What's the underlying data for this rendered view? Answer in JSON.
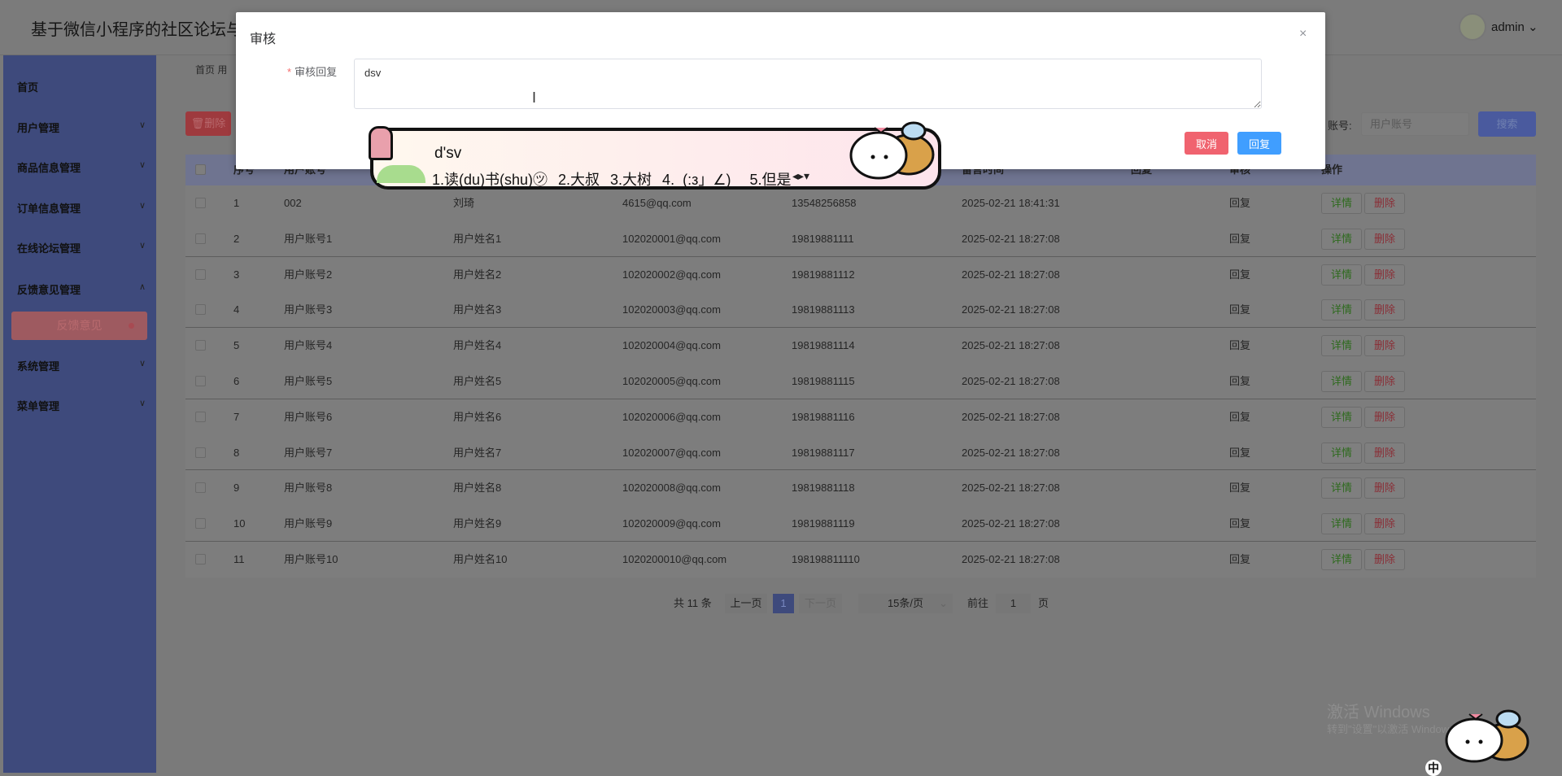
{
  "header": {
    "title": "基于微信小程序的社区论坛与二",
    "user": "admin",
    "user_chevron": "⌄"
  },
  "sidebar": {
    "items": [
      {
        "label": "首页",
        "chevron": ""
      },
      {
        "label": "用户管理",
        "chevron": "∨"
      },
      {
        "label": "商品信息管理",
        "chevron": "∨"
      },
      {
        "label": "订单信息管理",
        "chevron": "∨"
      },
      {
        "label": "在线论坛管理",
        "chevron": "∨"
      },
      {
        "label": "反馈意见管理",
        "chevron": "∧"
      },
      {
        "label": "系统管理",
        "chevron": "∨"
      },
      {
        "label": "菜单管理",
        "chevron": "∨"
      }
    ],
    "active_sub": "反馈意见"
  },
  "breadcrumb": "首页   用",
  "toolbar": {
    "delete_label": "🗑删除",
    "search_label": "账号:",
    "search_placeholder": "用户账号",
    "search_button": "搜索"
  },
  "table": {
    "headers": [
      "序号",
      "用户账号",
      "",
      "",
      "",
      "留言时间",
      "回复",
      "审核",
      "操作"
    ],
    "detail_label": "详情",
    "delete_label": "删除",
    "rows": [
      [
        "1",
        "002",
        "刘琦",
        "4615@qq.com",
        "13548256858",
        "2025-02-21 18:41:31",
        "",
        "回复"
      ],
      [
        "2",
        "用户账号1",
        "用户姓名1",
        "102020001@qq.com",
        "19819881111",
        "2025-02-21 18:27:08",
        "",
        "回复"
      ],
      [
        "3",
        "用户账号2",
        "用户姓名2",
        "102020002@qq.com",
        "19819881112",
        "2025-02-21 18:27:08",
        "",
        "回复"
      ],
      [
        "4",
        "用户账号3",
        "用户姓名3",
        "102020003@qq.com",
        "19819881113",
        "2025-02-21 18:27:08",
        "",
        "回复"
      ],
      [
        "5",
        "用户账号4",
        "用户姓名4",
        "102020004@qq.com",
        "19819881114",
        "2025-02-21 18:27:08",
        "",
        "回复"
      ],
      [
        "6",
        "用户账号5",
        "用户姓名5",
        "102020005@qq.com",
        "19819881115",
        "2025-02-21 18:27:08",
        "",
        "回复"
      ],
      [
        "7",
        "用户账号6",
        "用户姓名6",
        "102020006@qq.com",
        "19819881116",
        "2025-02-21 18:27:08",
        "",
        "回复"
      ],
      [
        "8",
        "用户账号7",
        "用户姓名7",
        "102020007@qq.com",
        "19819881117",
        "2025-02-21 18:27:08",
        "",
        "回复"
      ],
      [
        "9",
        "用户账号8",
        "用户姓名8",
        "102020008@qq.com",
        "19819881118",
        "2025-02-21 18:27:08",
        "",
        "回复"
      ],
      [
        "10",
        "用户账号9",
        "用户姓名9",
        "102020009@qq.com",
        "19819881119",
        "2025-02-21 18:27:08",
        "",
        "回复"
      ],
      [
        "11",
        "用户账号10",
        "用户姓名10",
        "1020200010@qq.com",
        "198198811110",
        "2025-02-21 18:27:08",
        "",
        "回复"
      ]
    ]
  },
  "pagination": {
    "total": "共 11 条",
    "prev": "上一页",
    "current": "1",
    "next": "下一页",
    "page_size": "15条/页",
    "goto_label": "前往",
    "goto_value": "1",
    "page_unit": "页"
  },
  "modal": {
    "title": "审核",
    "close": "×",
    "field_required": "*",
    "field_label": "审核回复",
    "field_value": "dsv",
    "cancel": "取消",
    "submit": "回复"
  },
  "ime": {
    "composition": "d'sv",
    "candidates": "1.读(du)书(shu)㋡ 2.大叔 3.大树 4._(:з」∠)_ 5.但是",
    "arrows": "◂▸▾"
  },
  "watermark": {
    "line1": "激活 Windows",
    "line2": "转到\"设置\"以激活 Windows。"
  },
  "ime_indicator": "中"
}
